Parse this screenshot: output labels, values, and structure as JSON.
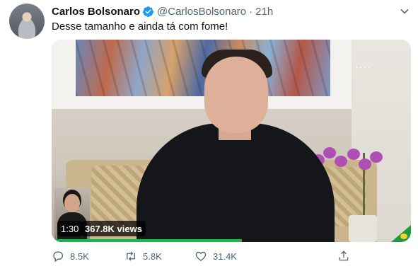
{
  "tweet": {
    "display_name": "Carlos Bolsonaro",
    "handle": "@CarlosBolsonaro",
    "separator": "·",
    "time": "21h",
    "text": "Desse tamanho e ainda tá com fome!"
  },
  "media": {
    "duration": "1:30",
    "views": "367.8K views",
    "progress_fraction": 0.53,
    "progress_color": "#1ab54a"
  },
  "actions": {
    "reply_count": "8.5K",
    "retweet_count": "5.8K",
    "like_count": "31.4K"
  },
  "icons": {
    "verified": "verified-badge-icon",
    "more": "chevron-down-icon",
    "reply": "reply-icon",
    "retweet": "retweet-icon",
    "like": "heart-icon",
    "share": "share-icon"
  },
  "colors": {
    "accent": "#1d9bf0",
    "secondary_text": "#536471",
    "primary_text": "#0f1419"
  }
}
